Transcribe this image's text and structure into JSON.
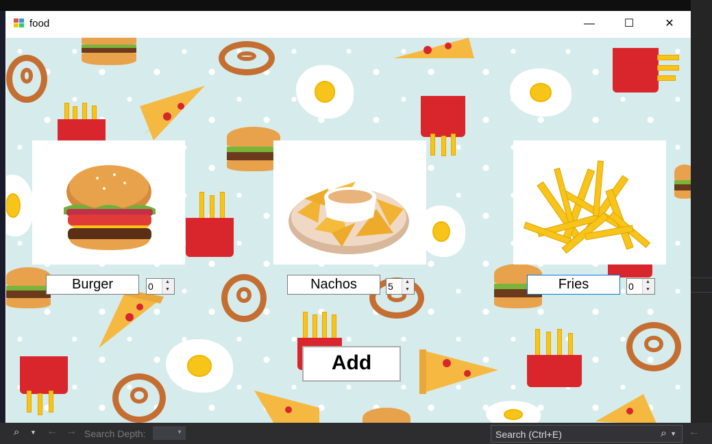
{
  "window": {
    "title": "food",
    "controls": {
      "minimize": "—",
      "maximize": "☐",
      "close": "✕"
    }
  },
  "products": [
    {
      "name": "Burger",
      "quantity": "0",
      "image": "burger-image"
    },
    {
      "name": "Nachos",
      "quantity": "5",
      "image": "nachos-image"
    },
    {
      "name": "Fries",
      "quantity": "0",
      "image": "fries-image"
    }
  ],
  "add_button": {
    "label": "Add"
  },
  "ide_toolbar": {
    "search_depth_label": "Search Depth:",
    "search_placeholder": "Search (Ctrl+E)"
  },
  "colors": {
    "background": "#d6ecec",
    "focus_border": "#0078d7",
    "ide_dark": "#2d2d30"
  }
}
